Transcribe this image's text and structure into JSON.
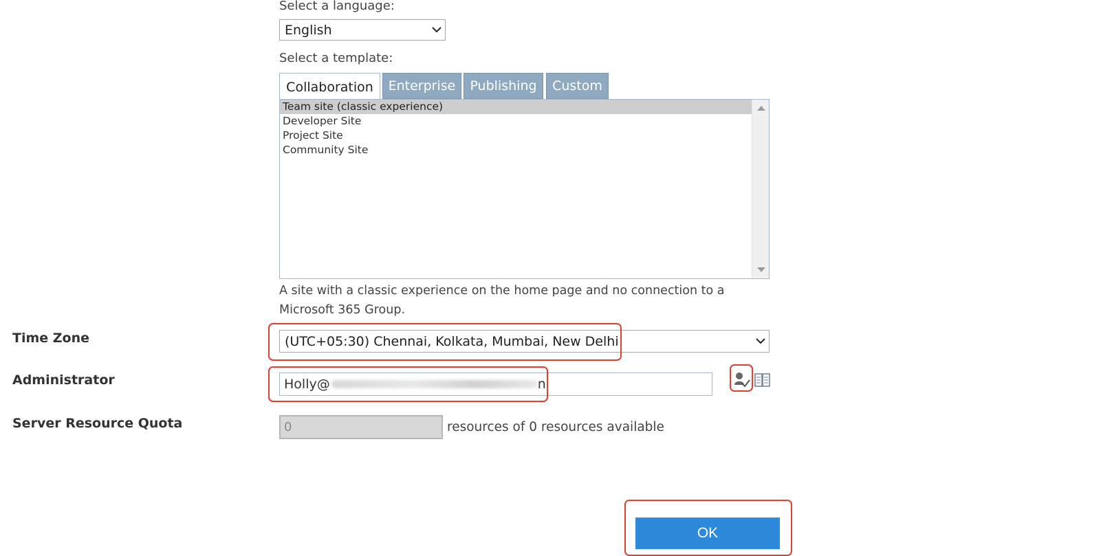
{
  "language": {
    "label": "Select a language:",
    "selected": "English"
  },
  "template": {
    "label": "Select a template:",
    "tabs": [
      {
        "label": "Collaboration",
        "active": true
      },
      {
        "label": "Enterprise",
        "active": false
      },
      {
        "label": "Publishing",
        "active": false
      },
      {
        "label": "Custom",
        "active": false
      }
    ],
    "items": [
      {
        "label": "Team site (classic experience)",
        "selected": true
      },
      {
        "label": "Developer Site",
        "selected": false
      },
      {
        "label": "Project Site",
        "selected": false
      },
      {
        "label": "Community Site",
        "selected": false
      }
    ],
    "description": "A site with a classic experience on the home page and no connection to a Microsoft 365 Group."
  },
  "time_zone": {
    "label": "Time Zone",
    "selected": "(UTC+05:30) Chennai, Kolkata, Mumbai, New Delhi"
  },
  "administrator": {
    "label": "Administrator",
    "value_visible": "Holly@",
    "value_tail": "n",
    "icons": [
      "check-names-icon",
      "browse-directory-icon"
    ]
  },
  "server_resource_quota": {
    "label": "Server Resource Quota",
    "value": "0",
    "suffix": "resources of 0 resources available"
  },
  "ok_button": {
    "label": "OK"
  },
  "colors": {
    "tab_inactive": "#8fa9c0",
    "ok_button": "#2d89d9",
    "highlight": "#e0402a",
    "selected_item": "#cdcdcd"
  }
}
